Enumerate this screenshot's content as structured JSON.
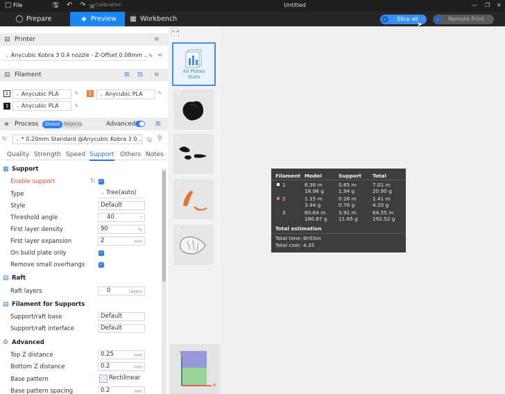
{
  "titlebar": {
    "file": "File",
    "calibration": "Calibration",
    "title": "Untitled",
    "minimize": "—",
    "restore": "❐",
    "close": "✕"
  },
  "tabs": {
    "prepare": "Prepare",
    "preview": "Preview",
    "workbench": "Workbench"
  },
  "toolbar": {
    "slice_all": "Slice all",
    "remote_print": "Remote Print"
  },
  "printer": {
    "header": "Printer",
    "preset": "Anycubic Kobra 3 0.4 nozzle - Z-Offset 0.08mm ..."
  },
  "filament": {
    "header": "Filament",
    "slots": [
      {
        "num": "1",
        "name": "Anycubic PLA",
        "color": "#ffffff"
      },
      {
        "num": "2",
        "name": "Anycubic PLA",
        "color": "#f08040"
      },
      {
        "num": "3",
        "name": "Anycubic PLA",
        "color": "#111111"
      }
    ]
  },
  "process": {
    "header": "Process",
    "global": "Global",
    "objects": "Objects",
    "advanced": "Advanced",
    "preset": "* 0.20mm Standard @Anycubic Kobra 3 0...",
    "subtabs": [
      "Quality",
      "Strength",
      "Speed",
      "Support",
      "Others",
      "Notes"
    ]
  },
  "support": {
    "title": "Support",
    "enable_support": "Enable support",
    "type_label": "Type",
    "type_value": "Tree(auto)",
    "style_label": "Style",
    "style_value": "Default",
    "threshold_label": "Threshold angle",
    "threshold_value": "40",
    "threshold_unit": "°",
    "first_layer_density_label": "First layer density",
    "first_layer_density_value": "90",
    "first_layer_density_unit": "%",
    "first_layer_expansion_label": "First layer expansion",
    "first_layer_expansion_value": "2",
    "first_layer_expansion_unit": "mm",
    "build_plate_only": "On build plate only",
    "remove_overhangs": "Remove small overhangs"
  },
  "raft": {
    "title": "Raft",
    "layers_label": "Raft layers",
    "layers_value": "0",
    "layers_unit": "layers"
  },
  "filament_supports": {
    "title": "Filament for Supports",
    "base_label": "Support/raft base",
    "base_value": "Default",
    "interface_label": "Support/raft interface",
    "interface_value": "Default"
  },
  "advanced": {
    "title": "Advanced",
    "top_z_label": "Top Z distance",
    "top_z_value": "0.25",
    "top_z_unit": "mm",
    "bottom_z_label": "Bottom Z distance",
    "bottom_z_value": "0.2",
    "bottom_z_unit": "mm",
    "base_pattern_label": "Base pattern",
    "base_pattern_value": "Rectilinear",
    "spacing_label": "Base pattern spacing",
    "spacing_value": "0.2",
    "spacing_unit": "mm"
  },
  "plates": {
    "all_line1": "All Plates",
    "all_line2": "Stats",
    "numbers": [
      "1",
      "2",
      "3",
      "4"
    ]
  },
  "stats": {
    "headers": [
      "Filament",
      "Model",
      "Support",
      "Total"
    ],
    "rows": [
      {
        "id": "1",
        "color": "#ffffff",
        "model": [
          "6.36 m",
          "18.96 g"
        ],
        "support": [
          "0.65 m",
          "1.94 g"
        ],
        "total": [
          "7.01 m",
          "20.90 g"
        ]
      },
      {
        "id": "2",
        "color": "#f07840",
        "model": [
          "1.15 m",
          "3.44 g"
        ],
        "support": [
          "0.26 m",
          "0.76 g"
        ],
        "total": [
          "1.41 m",
          "4.20 g"
        ]
      },
      {
        "id": "3",
        "color": "#111111",
        "model": [
          "60.64 m",
          "180.87 g"
        ],
        "support": [
          "3.91 m",
          "11.65 g"
        ],
        "total": [
          "64.55 m",
          "192.52 g"
        ]
      }
    ],
    "total_title": "Total estimation",
    "time_label": "Total time:",
    "time_value": "6h55m",
    "cost_label": "Total cost:",
    "cost_value": "4.35"
  },
  "gizmo": {
    "x": "x",
    "y": "y"
  }
}
